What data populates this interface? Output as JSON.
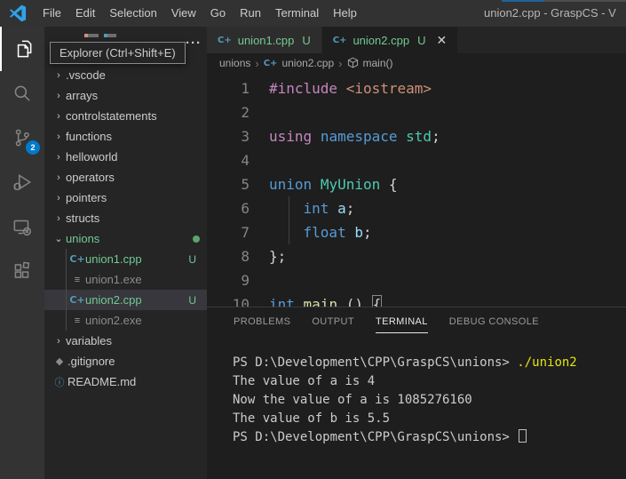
{
  "window": {
    "title": "union2.cpp - GraspCS - V",
    "menus": [
      "File",
      "Edit",
      "Selection",
      "View",
      "Go",
      "Run",
      "Terminal",
      "Help"
    ]
  },
  "colors": {
    "accent": "#007ACC",
    "git_untracked_green": "#73C991",
    "terminal_command_yellow": "#E5E510",
    "activity_icon_gray": "#858585",
    "editor_bg": "#1E1E1E",
    "sidebar_bg": "#252526",
    "activitybar_bg": "#333333",
    "titlebar_bg": "#323233",
    "selection_row_bg": "#37373D"
  },
  "activity_bar": {
    "items": [
      {
        "name": "explorer-icon",
        "active": true
      },
      {
        "name": "search-icon",
        "active": false
      },
      {
        "name": "source-control-icon",
        "active": false,
        "badge": "2"
      },
      {
        "name": "run-debug-icon",
        "active": false
      },
      {
        "name": "remote-explorer-icon",
        "active": false
      },
      {
        "name": "extensions-icon",
        "active": false
      }
    ]
  },
  "tooltip": {
    "text": "Explorer (Ctrl+Shift+E)"
  },
  "sidebar": {
    "more_actions_glyph": "···",
    "tree": [
      {
        "label": ".vscode",
        "kind": "folder"
      },
      {
        "label": "arrays",
        "kind": "folder"
      },
      {
        "label": "controlstatements",
        "kind": "folder"
      },
      {
        "label": "functions",
        "kind": "folder"
      },
      {
        "label": "helloworld",
        "kind": "folder"
      },
      {
        "label": "operators",
        "kind": "folder"
      },
      {
        "label": "pointers",
        "kind": "folder"
      },
      {
        "label": "structs",
        "kind": "folder"
      },
      {
        "label": "unions",
        "kind": "folder",
        "expanded": true,
        "green": true,
        "dot": true
      },
      {
        "label": "union1.cpp",
        "kind": "file",
        "icon": "cpp",
        "green": true,
        "badge": "U",
        "child": true
      },
      {
        "label": "union1.exe",
        "kind": "file",
        "icon": "exe",
        "dimmed": true,
        "child": true
      },
      {
        "label": "union2.cpp",
        "kind": "file",
        "icon": "cpp",
        "green": true,
        "badge": "U",
        "child": true,
        "selected": true
      },
      {
        "label": "union2.exe",
        "kind": "file",
        "icon": "exe",
        "dimmed": true,
        "child": true
      },
      {
        "label": "variables",
        "kind": "folder"
      },
      {
        "label": ".gitignore",
        "kind": "file",
        "icon": "diamond"
      },
      {
        "label": "README.md",
        "kind": "file",
        "icon": "info"
      }
    ]
  },
  "tabs": [
    {
      "label": "union1.cpp",
      "badge": "U",
      "active": false,
      "close": false
    },
    {
      "label": "union2.cpp",
      "badge": "U",
      "active": true,
      "close": true
    }
  ],
  "breadcrumb": [
    {
      "label": "unions",
      "icon": null
    },
    {
      "label": "union2.cpp",
      "icon": "cpp"
    },
    {
      "label": "main()",
      "icon": "cube"
    }
  ],
  "editor": {
    "lines": [
      {
        "n": "1",
        "tokens": [
          [
            "pp",
            "#include"
          ],
          [
            "plain",
            " "
          ],
          [
            "str",
            "<iostream>"
          ]
        ]
      },
      {
        "n": "2",
        "tokens": []
      },
      {
        "n": "3",
        "tokens": [
          [
            "pp",
            "using"
          ],
          [
            "plain",
            " "
          ],
          [
            "kw",
            "namespace"
          ],
          [
            "plain",
            " "
          ],
          [
            "type",
            "std"
          ],
          [
            "plain",
            ";"
          ]
        ]
      },
      {
        "n": "4",
        "tokens": []
      },
      {
        "n": "5",
        "tokens": [
          [
            "kw",
            "union"
          ],
          [
            "plain",
            " "
          ],
          [
            "type",
            "MyUnion"
          ],
          [
            "plain",
            " {"
          ]
        ]
      },
      {
        "n": "6",
        "tokens": [
          [
            "ind",
            "    "
          ],
          [
            "kw",
            "int"
          ],
          [
            "plain",
            " "
          ],
          [
            "var",
            "a"
          ],
          [
            "plain",
            ";"
          ]
        ]
      },
      {
        "n": "7",
        "tokens": [
          [
            "ind",
            "    "
          ],
          [
            "kw",
            "float"
          ],
          [
            "plain",
            " "
          ],
          [
            "var",
            "b"
          ],
          [
            "plain",
            ";"
          ]
        ]
      },
      {
        "n": "8",
        "tokens": [
          [
            "plain",
            "};"
          ]
        ]
      },
      {
        "n": "9",
        "tokens": []
      },
      {
        "n": "10",
        "tokens": [
          [
            "kw",
            "int"
          ],
          [
            "plain",
            " "
          ],
          [
            "fn",
            "main"
          ],
          [
            "plain",
            " () "
          ],
          [
            "boxed",
            "{"
          ]
        ]
      }
    ]
  },
  "panel": {
    "tabs": [
      "PROBLEMS",
      "OUTPUT",
      "TERMINAL",
      "DEBUG CONSOLE"
    ],
    "active_tab": "TERMINAL",
    "terminal_lines": [
      {
        "spans": [
          [
            "text",
            "PS D:\\Development\\CPP\\GraspCS\\unions> "
          ],
          [
            "cmd",
            "./union2"
          ]
        ]
      },
      {
        "spans": [
          [
            "text",
            "The value of a is 4"
          ]
        ]
      },
      {
        "spans": [
          [
            "text",
            "Now the value of a is 1085276160"
          ]
        ]
      },
      {
        "spans": [
          [
            "text",
            "The value of b is 5.5"
          ]
        ]
      },
      {
        "spans": [
          [
            "text",
            "PS D:\\Development\\CPP\\GraspCS\\unions> "
          ],
          [
            "cursor",
            ""
          ]
        ]
      }
    ]
  }
}
